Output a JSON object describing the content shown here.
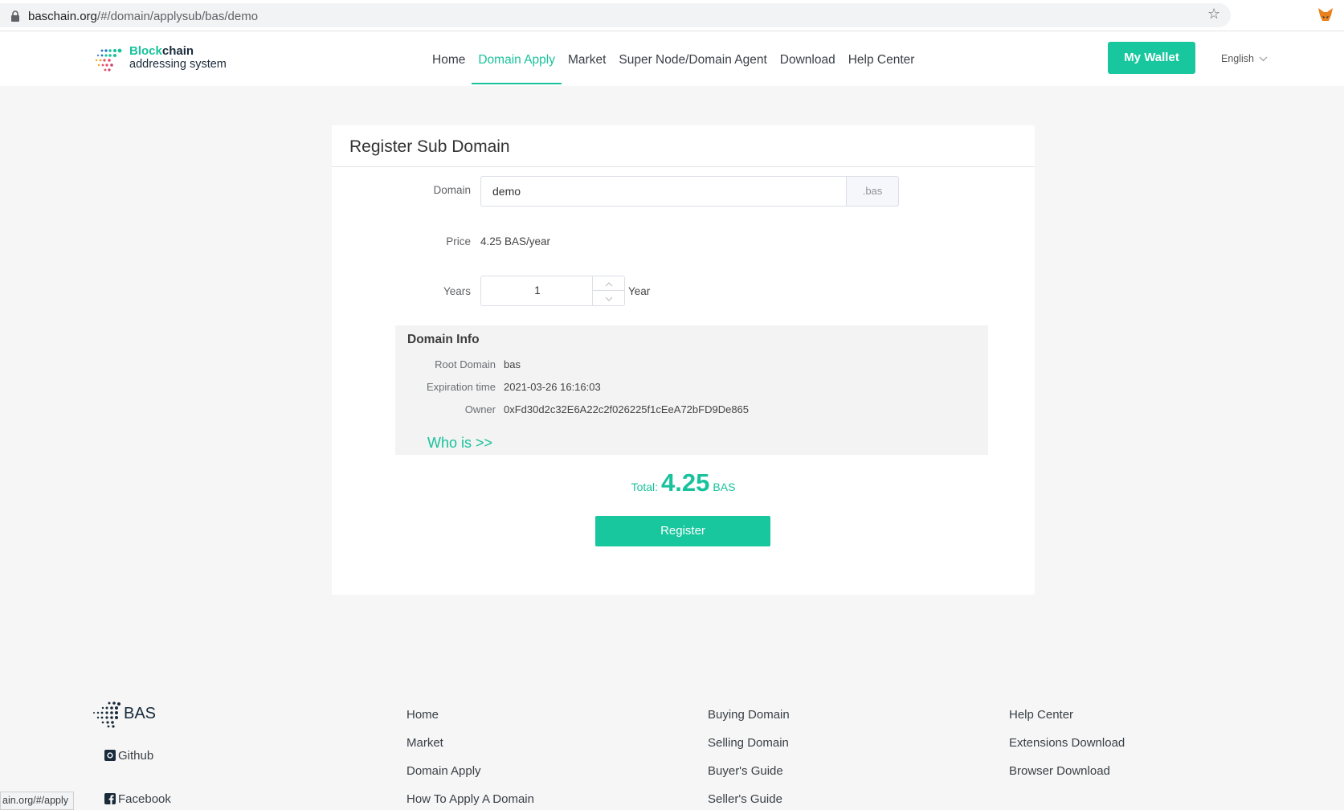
{
  "browser": {
    "url_host": "baschain.org",
    "url_path": "/#/domain/applysub/bas/demo",
    "status_url": "ain.org/#/apply"
  },
  "header": {
    "logo_line1_a": "Block",
    "logo_line1_b": "chain",
    "logo_line2": "addressing system",
    "nav": [
      "Home",
      "Domain Apply",
      "Market",
      "Super Node/Domain Agent",
      "Download",
      "Help Center"
    ],
    "active_nav": "Domain Apply",
    "wallet_label": "My Wallet",
    "language": "English"
  },
  "form": {
    "title": "Register Sub Domain",
    "domain_label": "Domain",
    "domain_value": "demo",
    "domain_suffix": ".bas",
    "price_label": "Price",
    "price_value": "4.25 BAS/year",
    "years_label": "Years",
    "years_value": "1",
    "years_unit": "Year",
    "info": {
      "title": "Domain Info",
      "root_label": "Root Domain",
      "root_value": "bas",
      "expiration_label": "Expiration time",
      "expiration_value": "2021-03-26 16:16:03",
      "owner_label": "Owner",
      "owner_value": "0xFd30d2c32E6A22c2f026225f1cEeA72bFD9De865",
      "whois": "Who is >>"
    },
    "total_label": "Total:",
    "total_value": "4.25",
    "total_unit": "BAS",
    "register_label": "Register"
  },
  "footer": {
    "brand": "BAS",
    "social": [
      "Github",
      "Facebook"
    ],
    "col1": [
      "Home",
      "Market",
      "Domain Apply",
      "How To Apply A Domain"
    ],
    "col2": [
      "Buying Domain",
      "Selling Domain",
      "Buyer's Guide",
      "Seller's Guide"
    ],
    "col3": [
      "Help Center",
      "Extensions Download",
      "Browser Download"
    ]
  },
  "colors": {
    "accent": "#18c29c",
    "button": "#18c79e"
  }
}
